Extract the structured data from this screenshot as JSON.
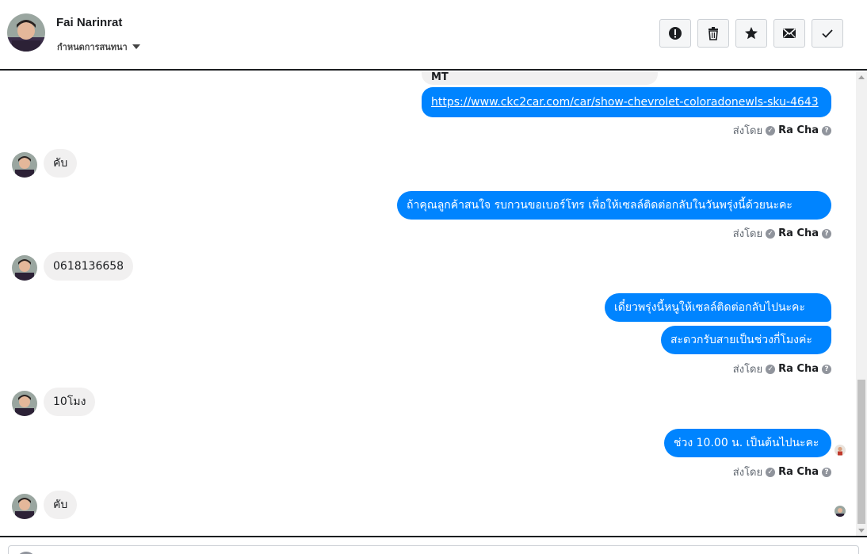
{
  "header": {
    "contact_name": "Fai Narinrat",
    "subline_label": "กำหนดการสนทนา"
  },
  "actions": [
    {
      "icon": "alert-icon"
    },
    {
      "icon": "trash-icon"
    },
    {
      "icon": "star-icon"
    },
    {
      "icon": "envelope-icon"
    },
    {
      "icon": "check-icon"
    }
  ],
  "messages": {
    "partial_top_text": "MT",
    "link_url": "https://www.ckc2car.com/car/show-chevrolet-coloradonewls-sku-4643",
    "in_1": "คับ",
    "out_2": "ถ้าคุณลูกค้าสนใจ รบกวนขอเบอร์โทร เพื่อให้เซลล์ติดต่อกลับในวันพรุ่งนี้ด้วยนะคะ",
    "in_2": "0618136658",
    "out_3a": "เดี๋ยวพรุ่งนี้หนูให้เซลล์ติดต่อกลับไปนะคะ",
    "out_3b": "สะดวกรับสายเป็นช่วงกี่โมงค่ะ",
    "in_3": "10โมง",
    "out_4": "ช่วง 10.00 น. เป็นต้นไปนะคะ",
    "in_4": "คับ"
  },
  "sent_by": {
    "prefix": "ส่งโดย",
    "agent": "Ra Cha",
    "help_glyph": "?"
  },
  "colors": {
    "outgoing": "#0084ff",
    "incoming": "#f1f0f0",
    "border": "#1c1e21"
  }
}
